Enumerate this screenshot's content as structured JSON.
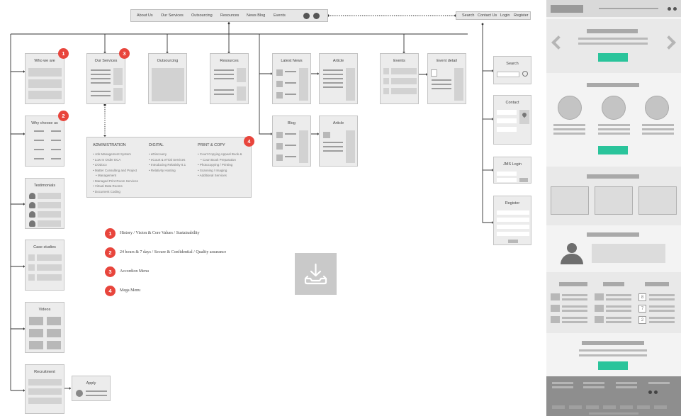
{
  "top_nav": {
    "items": [
      "About Us",
      "Our Services",
      "Outsourcing",
      "Resources",
      "News Blog",
      "Events"
    ],
    "social_icons": [
      "twitter-icon",
      "linkedin-icon"
    ]
  },
  "utility_nav": {
    "items": [
      "Search",
      "Contact Us",
      "Login",
      "Register"
    ]
  },
  "left_column": {
    "who_we_are": "Who we are",
    "why_choose_us": "Why choose us",
    "testimonials": "Testimonials",
    "case_studies": "Case studies",
    "videos": "Videos",
    "recruitment": "Recruitment",
    "apply": "Apply"
  },
  "nav_cards": {
    "our_services": "Our Services",
    "outsourcing": "Outsourcing",
    "resources": "Resources",
    "latest_news": "Latest News",
    "article_1": "Article",
    "blog": "Blog",
    "article_2": "Article",
    "events": "Events",
    "event_detail": "Event detail"
  },
  "right_column": {
    "search": "Search",
    "contact": "Contact",
    "jms_login": "JMS Login",
    "register": "Register"
  },
  "badges": [
    "1",
    "2",
    "3",
    "4"
  ],
  "mega_menu": {
    "columns": [
      {
        "heading": "ADMINISTRATION",
        "items": [
          "Job Management System",
          "Low In Order ECA",
          "LiOdoco",
          "Matter Consulting and Project",
          "Management",
          "Managed Print Room Services",
          "Virtual Data Rooms",
          "Document Coding"
        ]
      },
      {
        "heading": "DIGITAL",
        "items": [
          "eDiscovery",
          "eCourt & eTrial Services",
          "Introducing Relativity 8.1",
          "Relativity Hosting"
        ]
      },
      {
        "heading": "PRINT & COPY",
        "items": [
          "Court Copying Appeal Book &",
          "Court Book Preparation",
          "Photocopying / Printing",
          "Scanning / Imaging",
          "Additional Services"
        ]
      }
    ]
  },
  "legend": [
    {
      "num": "1",
      "text": "History / Vision & Core Values / Sustainability"
    },
    {
      "num": "2",
      "text": "24 hours & 7 days / Secure & Confidential / Quality assurance"
    },
    {
      "num": "3",
      "text": "Accordion Menu"
    },
    {
      "num": "4",
      "text": "Mega Menu"
    }
  ],
  "download_icon": "download-tray-icon",
  "mockup": {
    "event_numbers": [
      "8",
      "7",
      "2"
    ],
    "colors": {
      "accent": "#2ac49b",
      "badge": "#e8453c"
    }
  }
}
